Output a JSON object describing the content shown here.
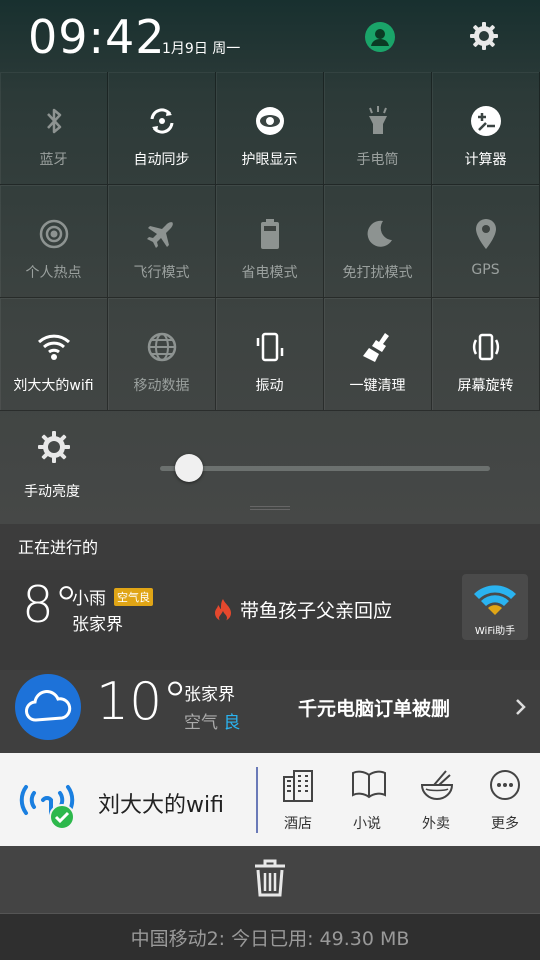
{
  "status": {
    "time": "09:42",
    "date": "1月9日 周一"
  },
  "tiles": [
    {
      "label": "蓝牙",
      "icon": "bluetooth-icon",
      "enabled": false
    },
    {
      "label": "自动同步",
      "icon": "sync-icon",
      "enabled": true
    },
    {
      "label": "护眼显示",
      "icon": "eye-icon",
      "enabled": true
    },
    {
      "label": "手电筒",
      "icon": "flashlight-icon",
      "enabled": false
    },
    {
      "label": "计算器",
      "icon": "calculator-icon",
      "enabled": true
    },
    {
      "label": "个人热点",
      "icon": "hotspot-icon",
      "enabled": false
    },
    {
      "label": "飞行模式",
      "icon": "airplane-icon",
      "enabled": false
    },
    {
      "label": "省电模式",
      "icon": "battery-icon",
      "enabled": false
    },
    {
      "label": "免打扰模式",
      "icon": "moon-icon",
      "enabled": false
    },
    {
      "label": "GPS",
      "icon": "location-pin-icon",
      "enabled": false
    },
    {
      "label": "刘大大的wifi",
      "icon": "wifi-icon",
      "enabled": true
    },
    {
      "label": "移动数据",
      "icon": "globe-icon",
      "enabled": false
    },
    {
      "label": "振动",
      "icon": "vibrate-icon",
      "enabled": true
    },
    {
      "label": "一键清理",
      "icon": "broom-icon",
      "enabled": true
    },
    {
      "label": "屏幕旋转",
      "icon": "rotate-icon",
      "enabled": true
    }
  ],
  "brightness": {
    "label": "手动亮度",
    "level": 0.05
  },
  "notifications": {
    "section_title": "正在进行的",
    "weather_small": {
      "temp": "8°",
      "condition": "小雨",
      "air_badge": "空气良",
      "city": "张家界",
      "headline": "带鱼孩子父亲回应",
      "wifi_assistant_label": "WiFi助手"
    },
    "weather_large": {
      "temp": "10°",
      "city": "张家界",
      "air_label": "空气",
      "air_value": "良",
      "headline": "千元电脑订单被删"
    },
    "wifi_card": {
      "name": "刘大大的wifi",
      "actions": [
        {
          "label": "酒店",
          "icon": "hotel-icon"
        },
        {
          "label": "小说",
          "icon": "book-icon"
        },
        {
          "label": "外卖",
          "icon": "noodle-bowl-icon"
        },
        {
          "label": "更多",
          "icon": "more-icon"
        }
      ]
    }
  },
  "carrier": "中国移动2: 今日已用: 49.30 MB",
  "colors": {
    "accent_green": "#1aa469",
    "badge_orange": "#e0a516",
    "weather_blue": "#1d72d9",
    "air_good": "#2ab3f0",
    "fire_red": "#e5482d"
  }
}
